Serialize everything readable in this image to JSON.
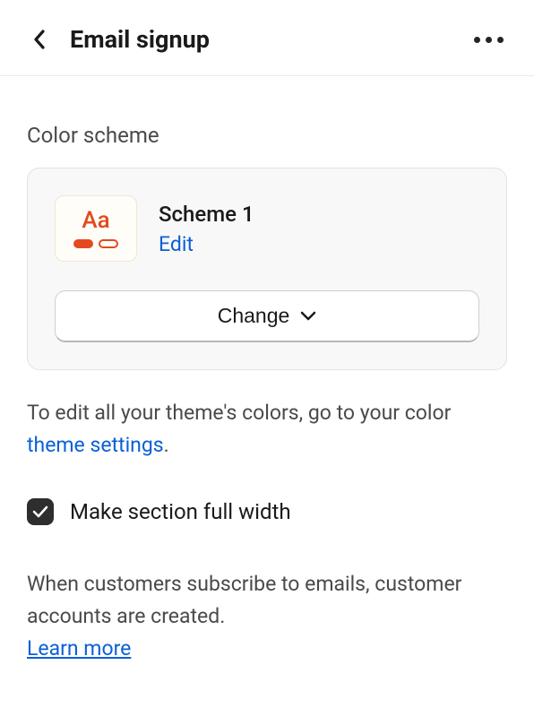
{
  "header": {
    "title": "Email signup"
  },
  "color_scheme": {
    "section_label": "Color scheme",
    "preview_text": "Aa",
    "scheme_name": "Scheme 1",
    "edit_label": "Edit",
    "change_label": "Change"
  },
  "help": {
    "prefix": "To edit all your theme's colors, go to your color ",
    "link_text": "theme settings",
    "suffix": "."
  },
  "checkbox": {
    "label": "Make section full width",
    "checked": true
  },
  "subscribe_info": {
    "text": "When customers subscribe to emails, customer accounts are created.",
    "learn_more": "Learn more"
  }
}
